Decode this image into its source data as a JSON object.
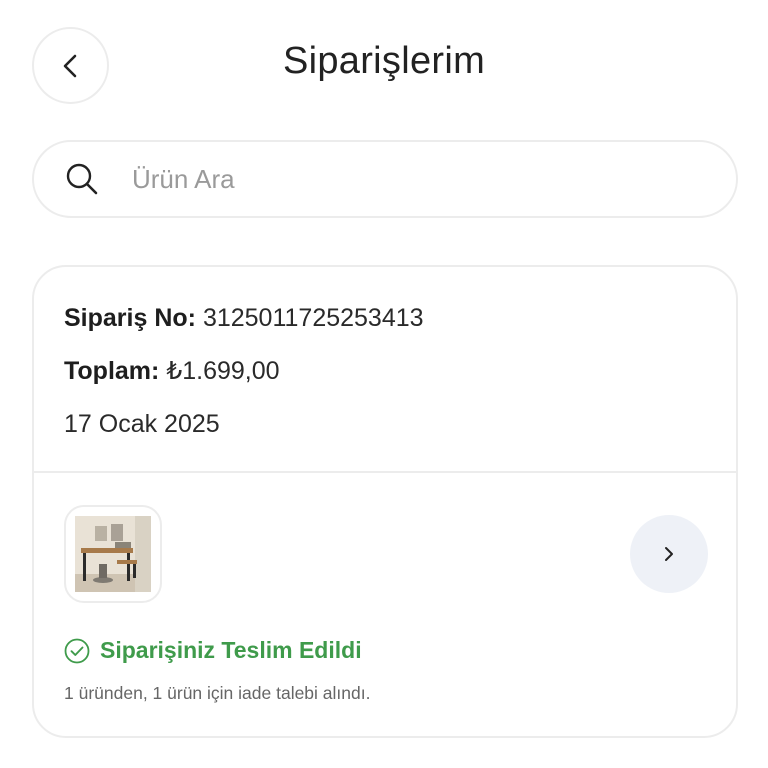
{
  "header": {
    "title": "Siparişlerim",
    "back_icon": "chevron-left-icon"
  },
  "search": {
    "placeholder": "Ürün Ara",
    "value": "",
    "icon": "search-icon"
  },
  "order": {
    "number_label": "Sipariş No:",
    "number_value": "3125011725253413",
    "total_label": "Toplam:",
    "total_value": "₺1.699,00",
    "date": "17 Ocak 2025",
    "status_text": "Siparişiniz Teslim Edildi",
    "status_color": "#3f9b4b",
    "status_icon": "check-circle-icon",
    "return_note": "1 üründen, 1 ürün için iade talebi alındı.",
    "detail_icon": "chevron-right-icon",
    "product_image": "product-thumbnail-desk"
  },
  "colors": {
    "border": "#ececec",
    "detail_button_bg": "#eef1f7",
    "status_green": "#3f9b4b"
  }
}
